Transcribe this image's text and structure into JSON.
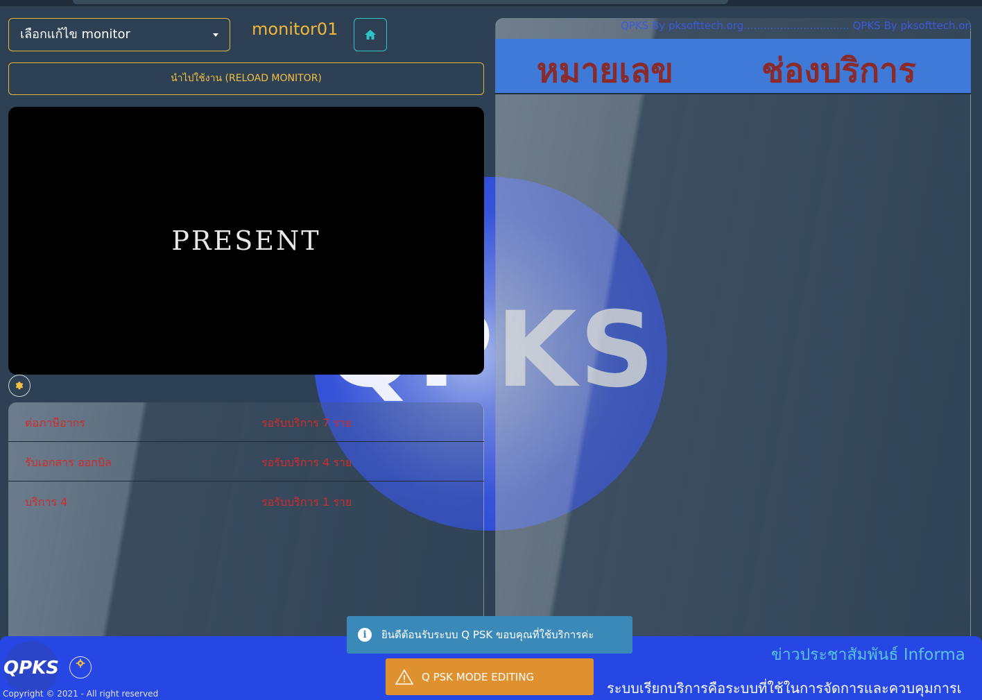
{
  "monitor_select": {
    "label": "เลือกแก้ไข monitor"
  },
  "monitor_name": "monitor01",
  "reload_button": "นำไปใช้งาน (RELOAD MONITOR)",
  "video": {
    "text": "PRESENT"
  },
  "background_logo": "QPKS",
  "queue_rows": [
    {
      "service": "ต่อภาษีอากร",
      "waiting": "รอรับบริการ 7 ราย"
    },
    {
      "service": "รับเอกสาร ออกบิล",
      "waiting": "รอรับบริการ 4 ราย"
    },
    {
      "service": "บริการ 4",
      "waiting": "รอรับบริการ 1 ราย"
    }
  ],
  "marquee_text": "QPKS By pksofttech.org................................ QPKS By pksofttech.org",
  "headers": {
    "number": "หมายเลข",
    "channel": "ช่องบริการ"
  },
  "footer": {
    "logo": "QPKS",
    "copyright": "Copyright © 2021 - All right reserved",
    "news_title": "ข่าวประชาสัมพันธ์ Informa",
    "news_text": "ระบบเรียกบริการคือระบบที่ใช้ในการจัดการและควบคุมการเ"
  },
  "toasts": {
    "info": "ยินดีต้อนรับระบบ Q PSK ขอบคุณที่ใช้บริการค่ะ",
    "warning": "Q PSK MODE EDITING"
  },
  "icons": {
    "home": "home-icon",
    "settings": "gear-icon",
    "info": "info-icon",
    "warning": "warning-icon",
    "caret": "caret-down-icon"
  },
  "colors": {
    "background": "#2e4154",
    "accent_gold": "#f0c040",
    "accent_teal": "#2ec3c9",
    "queue_text": "#d42a2a",
    "header_band": "#3f7ad8",
    "header_text": "#8a2a2a",
    "footer": "#2647e4",
    "toast_info": "#3a89b8",
    "toast_warning": "#e0912f"
  }
}
